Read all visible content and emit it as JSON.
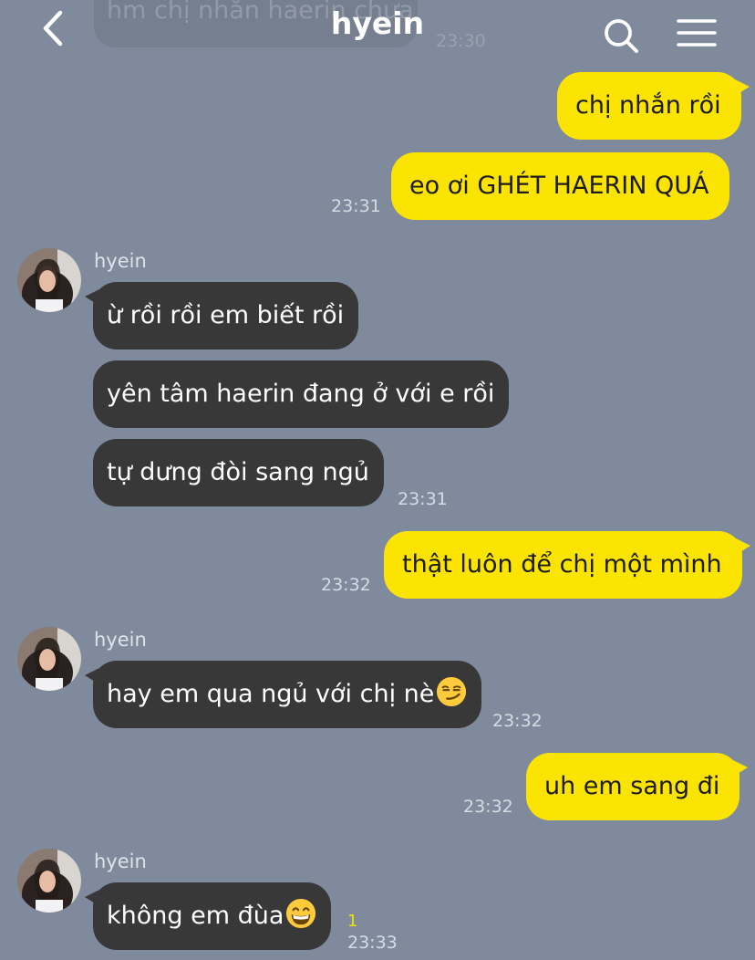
{
  "header": {
    "title": "hyein",
    "back_icon": "chevron-left-icon",
    "search_icon": "search-icon",
    "menu_icon": "hamburger-menu-icon"
  },
  "colors": {
    "background": "#7f8a9c",
    "outgoing_bubble": "#fbe401",
    "incoming_bubble": "#383839",
    "unread_count": "#f4e100"
  },
  "chat": {
    "previous": {
      "text": "hm chị nhắn haerin chưa",
      "time": "23:30"
    },
    "messages": [
      {
        "text": "chị nhắn rồi"
      },
      {
        "text": "eo ơi GHÉT HAERIN QUÁ",
        "time": "23:31"
      },
      {
        "sender": "hyein",
        "text": "ừ rồi rồi em biết rồi"
      },
      {
        "text": "yên tâm haerin đang ở với e rồi"
      },
      {
        "text": "tự dưng đòi sang ngủ",
        "time": "23:31"
      },
      {
        "text": "thật luôn để chị một mình",
        "time": "23:32"
      },
      {
        "sender": "hyein",
        "text": "hay em qua ngủ với chị nè",
        "emoji": "smirking-face-emoji",
        "time": "23:32"
      },
      {
        "text": "uh em sang đi",
        "time": "23:32"
      },
      {
        "sender": "hyein",
        "text": "không em đùa",
        "emoji": "grinning-face-emoji",
        "unread": "1",
        "time": "23:33"
      }
    ]
  }
}
